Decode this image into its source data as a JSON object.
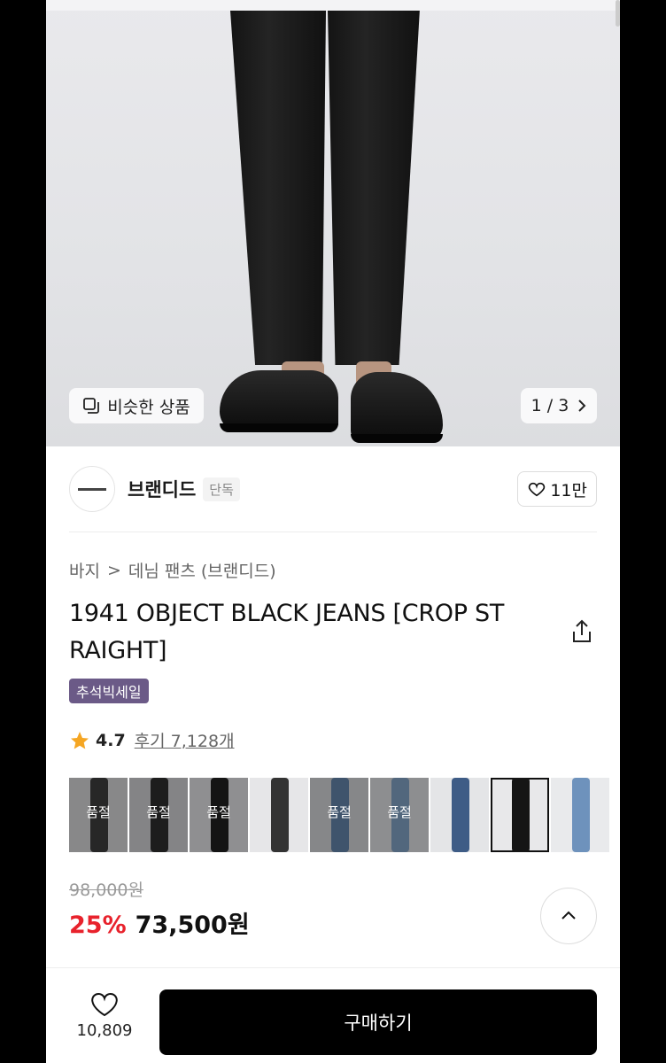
{
  "hero": {
    "similar_label": "비슷한 상품",
    "pager": {
      "current": "1",
      "separator": "/",
      "total": "3"
    }
  },
  "brand": {
    "name": "브랜디드",
    "tag": "단독",
    "likes": "11만"
  },
  "breadcrumb": {
    "level1": "바지",
    "separator": ">",
    "level2": "데님 팬츠 (브랜디드)"
  },
  "product": {
    "title_line1": "1941 OBJECT BLACK JEANS [CROP ST",
    "title_line2": "RAIGHT]",
    "badge": "추석빅세일",
    "rating": "4.7",
    "reviews": "후기 7,128개"
  },
  "thumbnails": [
    {
      "color": "#3a3a3a",
      "bg": "#c9c9cb",
      "sold_label": "품절"
    },
    {
      "color": "#2c2c2c",
      "bg": "#c3c3c6",
      "sold_label": "품절"
    },
    {
      "color": "#1e1e1e",
      "bg": "#d3d3d6",
      "sold_label": "품절"
    },
    {
      "color": "#333333",
      "bg": "#e6e6e8",
      "sold_label": ""
    },
    {
      "color": "#5d7da0",
      "bg": "#c6c7ca",
      "sold_label": "품절"
    },
    {
      "color": "#7a98b8",
      "bg": "#d0d1d4",
      "sold_label": "품절"
    },
    {
      "color": "#3e5c86",
      "bg": "#e4e5e7",
      "sold_label": ""
    },
    {
      "color": "#151515",
      "bg": "#e8e8ea",
      "sold_label": "",
      "selected": true
    },
    {
      "color": "#6e92bc",
      "bg": "#e9eaec",
      "sold_label": ""
    }
  ],
  "price": {
    "original": "98,000원",
    "discount": "25%",
    "sale": "73,500원"
  },
  "bottom": {
    "like_count": "10,809",
    "buy_label": "구매하기"
  },
  "colors": {
    "discount": "#e8222c",
    "badge": "#6b5a87",
    "star": "#f5a623"
  }
}
